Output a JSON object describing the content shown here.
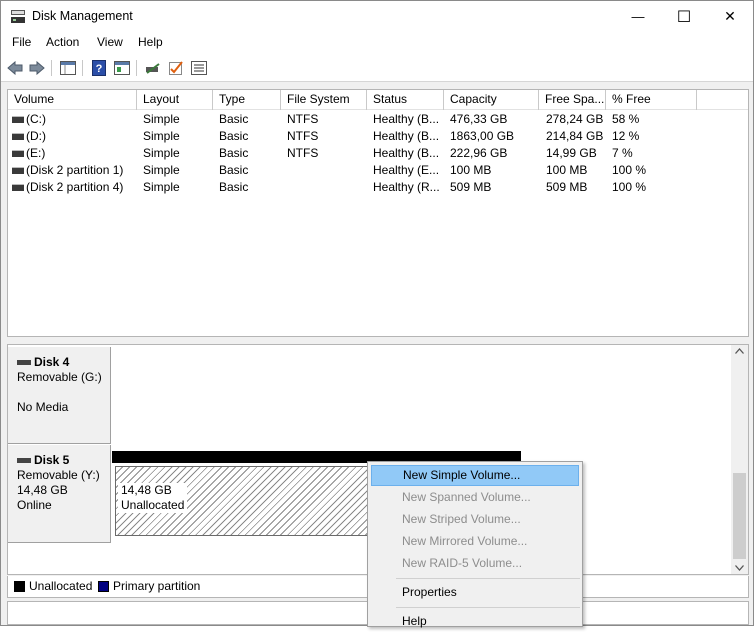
{
  "window": {
    "title": "Disk Management",
    "minimize_glyph": "—",
    "maximize_glyph": "☐",
    "close_glyph": "✕"
  },
  "menu": {
    "items": [
      "File",
      "Action",
      "View",
      "Help"
    ]
  },
  "toolbar": {
    "icons": [
      "back-icon",
      "forward-icon",
      "console-tree-icon",
      "help-icon",
      "properties-icon",
      "rescan-icon",
      "check-icon",
      "list-icon"
    ]
  },
  "volume_list": {
    "columns": [
      "Volume",
      "Layout",
      "Type",
      "File System",
      "Status",
      "Capacity",
      "Free Spa...",
      "% Free"
    ],
    "rows": [
      [
        "(C:)",
        "Simple",
        "Basic",
        "NTFS",
        "Healthy (B...",
        "476,33 GB",
        "278,24 GB",
        "58 %"
      ],
      [
        "(D:)",
        "Simple",
        "Basic",
        "NTFS",
        "Healthy (B...",
        "1863,00 GB",
        "214,84 GB",
        "12 %"
      ],
      [
        "(E:)",
        "Simple",
        "Basic",
        "NTFS",
        "Healthy (B...",
        "222,96 GB",
        "14,99 GB",
        "7 %"
      ],
      [
        "(Disk 2 partition 1)",
        "Simple",
        "Basic",
        "",
        "Healthy (E...",
        "100 MB",
        "100 MB",
        "100 %"
      ],
      [
        "(Disk 2 partition 4)",
        "Simple",
        "Basic",
        "",
        "Healthy (R...",
        "509 MB",
        "509 MB",
        "100 %"
      ]
    ]
  },
  "disks": [
    {
      "name": "Disk 4",
      "lines": [
        "Removable (G:)",
        "",
        "No Media"
      ]
    },
    {
      "name": "Disk 5",
      "lines": [
        "Removable (Y:)",
        "14,48 GB",
        "Online"
      ],
      "partition": {
        "size": "14,48 GB",
        "status": "Unallocated"
      }
    }
  ],
  "legend": [
    {
      "label": "Unallocated",
      "color": "#000000"
    },
    {
      "label": "Primary partition",
      "color": "#000080"
    }
  ],
  "context_menu": {
    "items": [
      {
        "label": "New Simple Volume...",
        "state": "highlighted"
      },
      {
        "label": "New Spanned Volume...",
        "state": "disabled"
      },
      {
        "label": "New Striped Volume...",
        "state": "disabled"
      },
      {
        "label": "New Mirrored Volume...",
        "state": "disabled"
      },
      {
        "label": "New RAID-5 Volume...",
        "state": "disabled"
      },
      {
        "label": "Properties",
        "state": "enabled"
      },
      {
        "label": "Help",
        "state": "enabled"
      }
    ]
  },
  "colors": {
    "highlight": "#91c9f7",
    "disabled_text": "#8d8d8d"
  }
}
